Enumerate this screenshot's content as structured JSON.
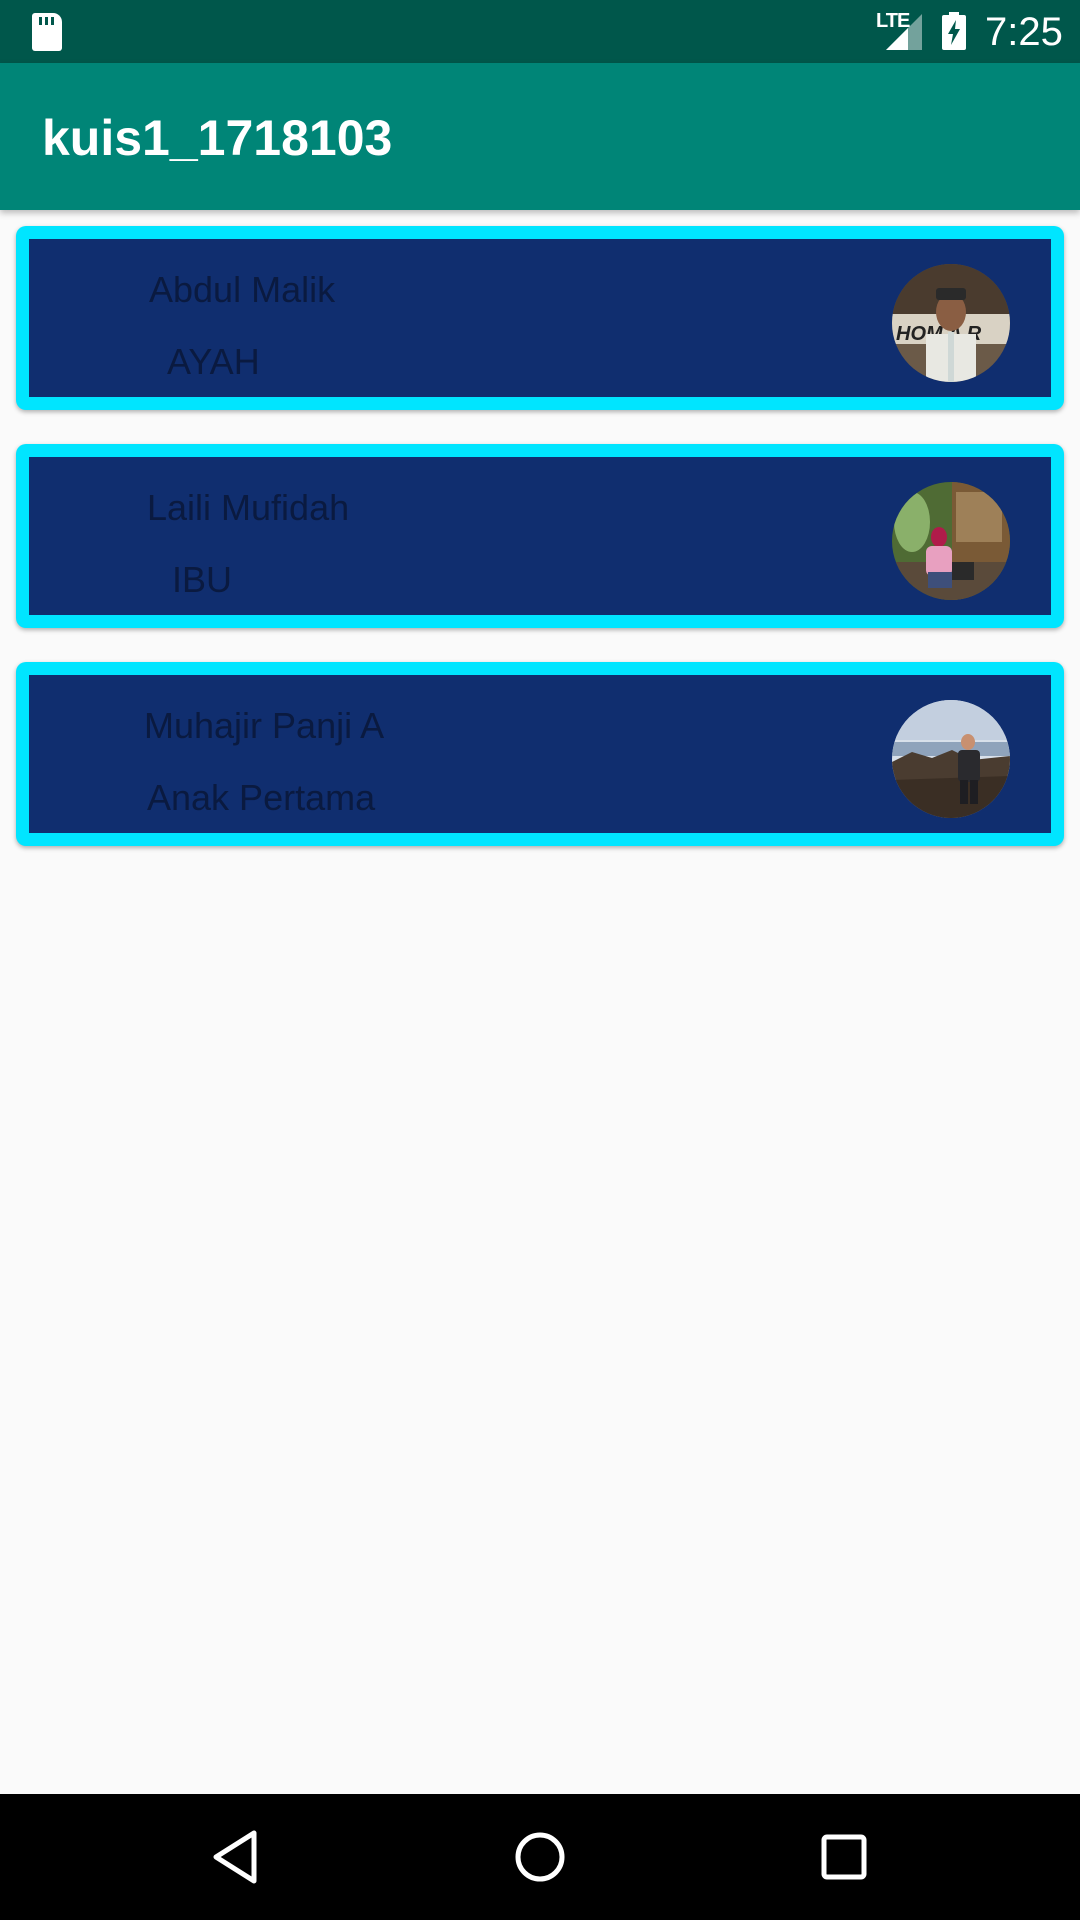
{
  "status_bar": {
    "network": "LTE",
    "time": "7:25",
    "icons": [
      "sd-card-icon",
      "signal-icon",
      "battery-charging-icon"
    ]
  },
  "app_bar": {
    "title": "kuis1_1718103"
  },
  "colors": {
    "status_bar": "#00574b",
    "app_bar": "#008577",
    "card_border": "#00e5ff",
    "card_fill": "#102e6f",
    "card_text": "#0a1a40",
    "background": "#fafafa"
  },
  "family_list": [
    {
      "name": "Abdul Malik",
      "role": "AYAH",
      "avatar": "photo-avatar"
    },
    {
      "name": "Laili Mufidah",
      "role": "IBU",
      "avatar": "photo-avatar"
    },
    {
      "name": "Muhajir Panji A",
      "role": "Anak Pertama",
      "avatar": "photo-avatar"
    }
  ],
  "nav_bar": {
    "icons": [
      "back-icon",
      "home-icon",
      "recents-icon"
    ]
  }
}
